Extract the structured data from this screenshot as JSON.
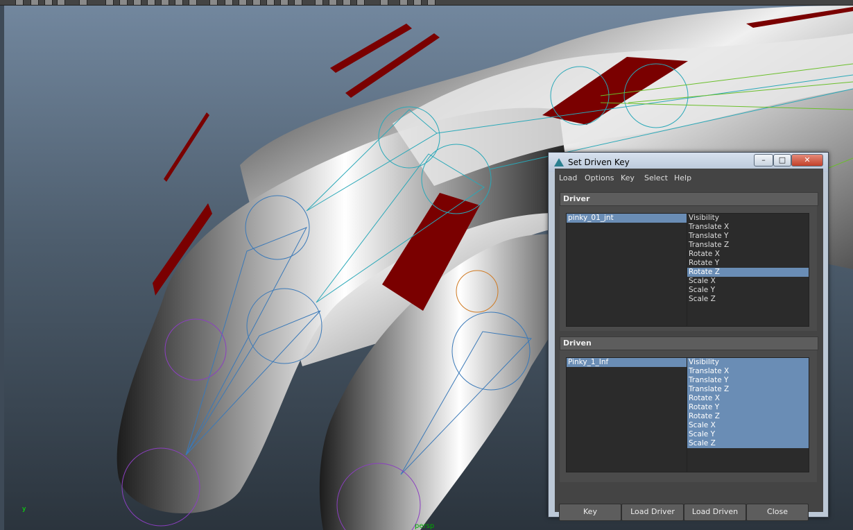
{
  "viewport": {
    "camera_label": "persp",
    "axis_label": "y"
  },
  "dialog": {
    "title": "Set Driven Key",
    "window_buttons": {
      "minimize": "–",
      "maximize": "□",
      "close": "✕"
    },
    "menu": [
      "Load",
      "Options",
      "Key",
      "Select",
      "Help"
    ],
    "driver": {
      "header": "Driver",
      "objects": [
        "pinky_01_jnt"
      ],
      "selected_object": 0,
      "attributes": [
        "Visibility",
        "Translate X",
        "Translate Y",
        "Translate Z",
        "Rotate X",
        "Rotate Y",
        "Rotate Z",
        "Scale X",
        "Scale Y",
        "Scale Z"
      ],
      "selected_attributes": [
        6
      ]
    },
    "driven": {
      "header": "Driven",
      "objects": [
        "Pinky_1_Inf"
      ],
      "selected_object": 0,
      "attributes": [
        "Visibility",
        "Translate X",
        "Translate Y",
        "Translate Z",
        "Rotate X",
        "Rotate Y",
        "Rotate Z",
        "Scale X",
        "Scale Y",
        "Scale Z"
      ],
      "selected_attributes": [
        0,
        1,
        2,
        3,
        4,
        5,
        6,
        7,
        8,
        9
      ]
    },
    "buttons": {
      "key": "Key",
      "load_driver": "Load Driver",
      "load_driven": "Load Driven",
      "close": "Close"
    }
  },
  "colors": {
    "selection": "#6a8db5",
    "joint_cyan": "#29a8b8",
    "joint_blue": "#3a79b8",
    "joint_purple": "#8b3fc0",
    "control_red": "#7a0000"
  }
}
